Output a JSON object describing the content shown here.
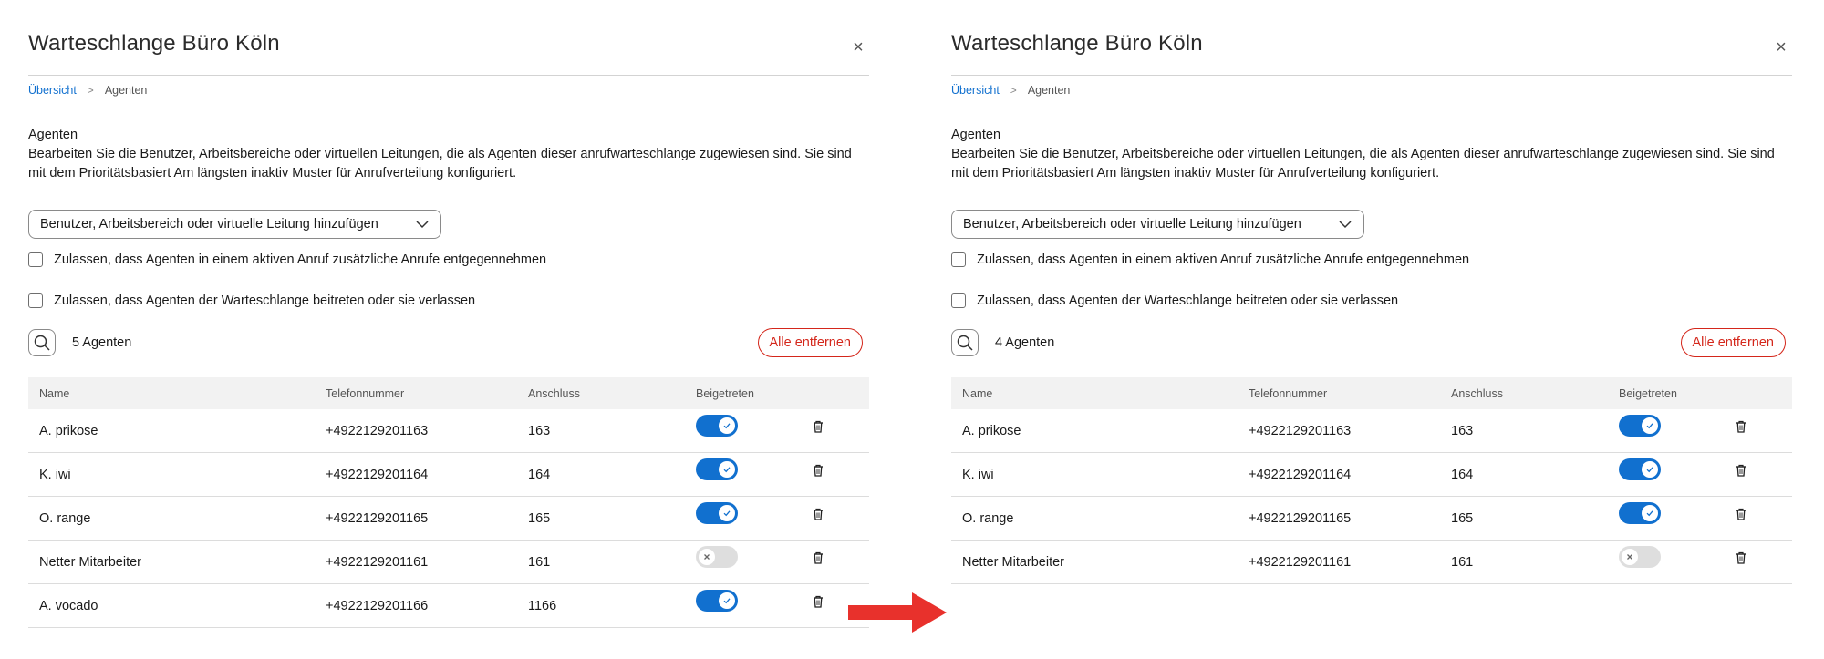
{
  "left": {
    "title": "Warteschlange Büro Köln",
    "close": "×",
    "breadcrumb": {
      "link": "Übersicht",
      "sep": ">",
      "current": "Agenten"
    },
    "section_title": "Agenten",
    "description": "Bearbeiten Sie die Benutzer, Arbeitsbereiche oder virtuellen Leitungen, die als Agenten dieser anrufwarteschlange zugewiesen sind. Sie sind mit dem Prioritätsbasiert Am längsten inaktiv Muster für Anrufverteilung konfiguriert.",
    "add_dropdown": "Benutzer, Arbeitsbereich oder virtuelle Leitung hinzufügen",
    "checkbox1": "Zulassen, dass Agenten in einem aktiven Anruf zusätzliche Anrufe entgegennehmen",
    "checkbox2": "Zulassen, dass Agenten der Warteschlange beitreten oder sie verlassen",
    "agent_count": "5 Agenten",
    "remove_all": "Alle entfernen",
    "columns": {
      "name": "Name",
      "phone": "Telefonnummer",
      "ext": "Anschluss",
      "joined": "Beigetreten"
    },
    "rows": [
      {
        "name": "A. prikose",
        "phone": "+4922129201163",
        "ext": "163",
        "joined": true
      },
      {
        "name": "K. iwi",
        "phone": "+4922129201164",
        "ext": "164",
        "joined": true
      },
      {
        "name": "O. range",
        "phone": "+4922129201165",
        "ext": "165",
        "joined": true
      },
      {
        "name": "Netter Mitarbeiter",
        "phone": "+4922129201161",
        "ext": "161",
        "joined": false
      },
      {
        "name": "A. vocado",
        "phone": "+4922129201166",
        "ext": "1166",
        "joined": true
      }
    ]
  },
  "right": {
    "title": "Warteschlange Büro Köln",
    "close": "×",
    "breadcrumb": {
      "link": "Übersicht",
      "sep": ">",
      "current": "Agenten"
    },
    "section_title": "Agenten",
    "description": "Bearbeiten Sie die Benutzer, Arbeitsbereiche oder virtuellen Leitungen, die als Agenten dieser anrufwarteschlange zugewiesen sind. Sie sind mit dem Prioritätsbasiert Am längsten inaktiv Muster für Anrufverteilung konfiguriert.",
    "add_dropdown": "Benutzer, Arbeitsbereich oder virtuelle Leitung hinzufügen",
    "checkbox1": "Zulassen, dass Agenten in einem aktiven Anruf zusätzliche Anrufe entgegennehmen",
    "checkbox2": "Zulassen, dass Agenten der Warteschlange beitreten oder sie verlassen",
    "agent_count": "4 Agenten",
    "remove_all": "Alle entfernen",
    "columns": {
      "name": "Name",
      "phone": "Telefonnummer",
      "ext": "Anschluss",
      "joined": "Beigetreten"
    },
    "rows": [
      {
        "name": "A. prikose",
        "phone": "+4922129201163",
        "ext": "163",
        "joined": true
      },
      {
        "name": "K. iwi",
        "phone": "+4922129201164",
        "ext": "164",
        "joined": true
      },
      {
        "name": "O. range",
        "phone": "+4922129201165",
        "ext": "165",
        "joined": true
      },
      {
        "name": "Netter Mitarbeiter",
        "phone": "+4922129201161",
        "ext": "161",
        "joined": false
      }
    ]
  },
  "colors": {
    "accent": "#1170cf",
    "danger": "#d4271b",
    "arrow": "#e8312c"
  },
  "icons": {
    "close": "close-icon",
    "chevron": "chevron-down-icon",
    "search": "search-icon",
    "trash": "trash-icon",
    "check": "check-icon",
    "x": "x-icon",
    "arrow": "arrow-right-icon"
  }
}
